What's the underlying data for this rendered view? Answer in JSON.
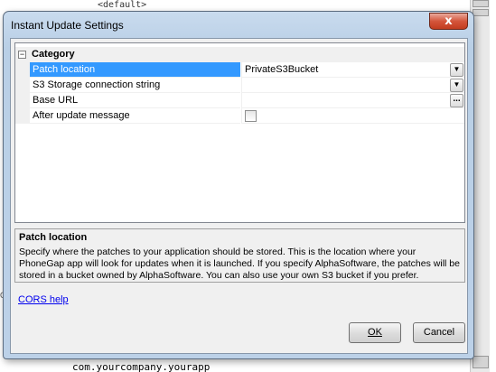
{
  "background": {
    "top_text": "<default>",
    "bottom_text": "com.yourcompany.yourapp",
    "left_text": "C"
  },
  "dialog": {
    "title": "Instant Update Settings",
    "close_label": "x"
  },
  "grid": {
    "category_toggle": "−",
    "category": "Category",
    "properties": [
      {
        "name": "Patch location",
        "value": "PrivateS3Bucket",
        "editor": "dropdown",
        "selected": true
      },
      {
        "name": "S3 Storage connection string",
        "value": "",
        "editor": "dropdown",
        "selected": false
      },
      {
        "name": "Base URL",
        "value": "",
        "editor": "ellipsis",
        "selected": false
      },
      {
        "name": "After update message",
        "value": "",
        "editor": "checkbox",
        "checked": false,
        "selected": false
      }
    ],
    "ellipsis_label": "..."
  },
  "description": {
    "title": "Patch location",
    "text": "Specify where the patches to your application should be stored. This is the location where your PhoneGap app will look for updates when it is launched. If you specify AlphaSoftware, the patches will be stored in a bucket owned by AlphaSoftware. You can also use your own S3 bucket if you prefer."
  },
  "cors_link": "CORS help",
  "buttons": {
    "ok": "OK",
    "cancel": "Cancel"
  },
  "colors": {
    "selection": "#3399ff",
    "link": "#0000ee",
    "close_button": "#d4553b"
  }
}
